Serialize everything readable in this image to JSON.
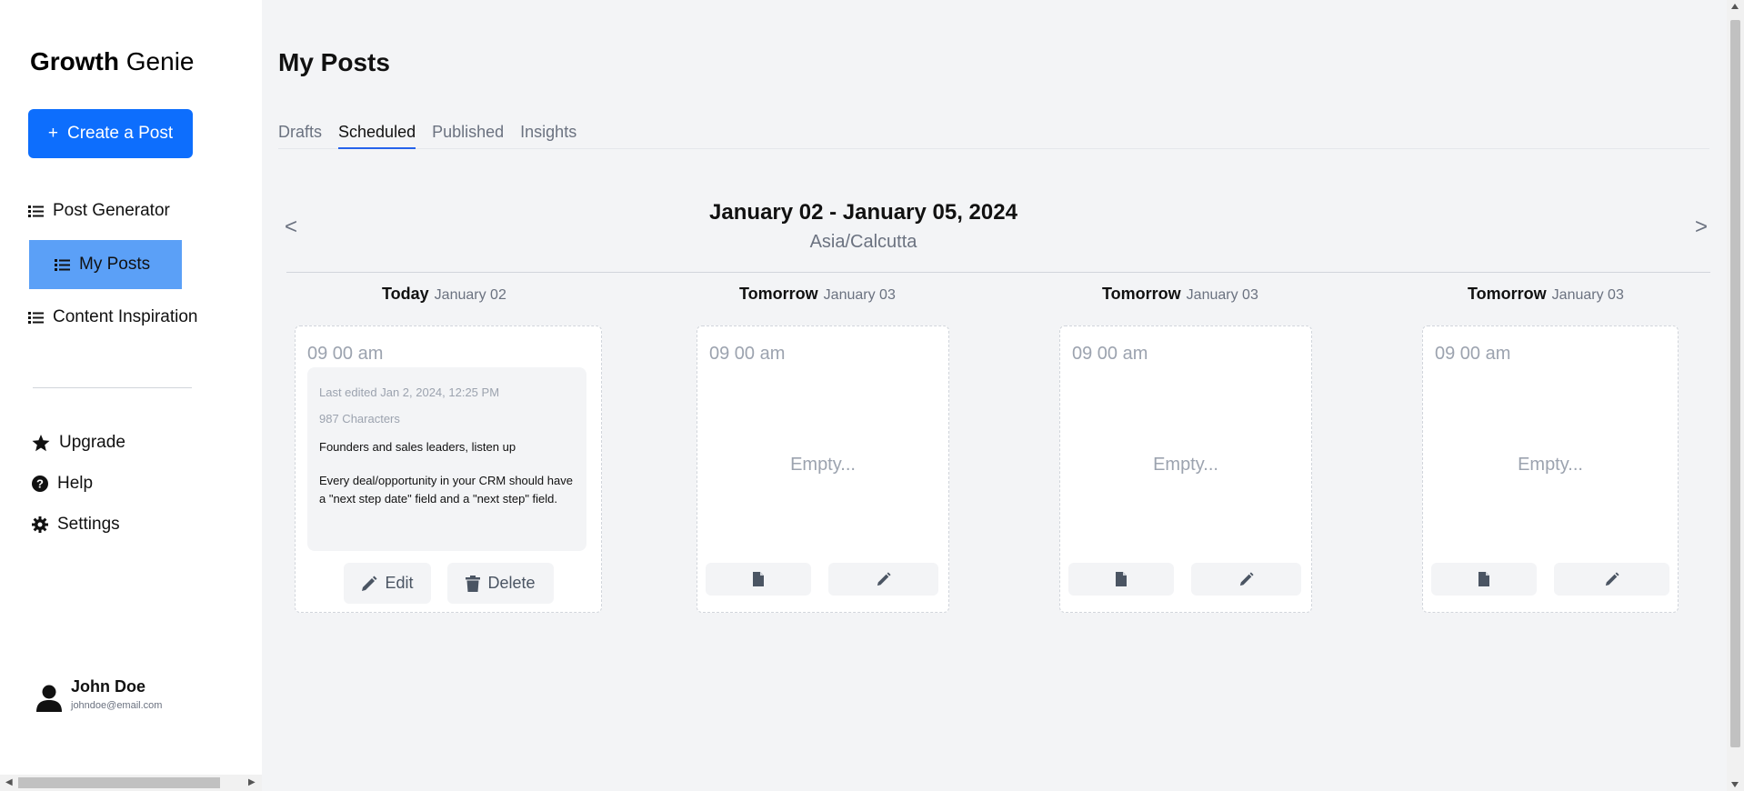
{
  "sidebar": {
    "brand_bold": "Growth",
    "brand_light": "Genie",
    "create_label": "Create a Post",
    "create_plus": "+",
    "nav": [
      {
        "label": "Post Generator",
        "icon": "list-icon"
      },
      {
        "label": "My Posts",
        "icon": "list-icon",
        "active": true
      },
      {
        "label": "Content Inspiration",
        "icon": "list-icon"
      }
    ],
    "secondary": [
      {
        "label": "Upgrade",
        "icon": "star-icon"
      },
      {
        "label": "Help",
        "icon": "question-circle-icon"
      },
      {
        "label": "Settings",
        "icon": "gear-icon"
      }
    ],
    "user": {
      "name": "John Doe",
      "email": "johndoe@email.com"
    }
  },
  "main": {
    "title": "My Posts",
    "tabs": [
      {
        "label": "Drafts"
      },
      {
        "label": "Scheduled",
        "active": true
      },
      {
        "label": "Published"
      },
      {
        "label": "Insights"
      }
    ],
    "range": {
      "title": "January 02 - January 05, 2024",
      "timezone": "Asia/Calcutta",
      "prev": "<",
      "next": ">"
    },
    "columns": [
      {
        "day": "Today",
        "date": "January 02",
        "time": "09 00 am",
        "post": {
          "edited": "Last edited Jan 2, 2024, 12:25 PM",
          "chars": "987 Characters",
          "line1": "Founders and sales leaders, listen up",
          "line2": "Every deal/opportunity in your CRM should have a \"next step date\" field and a \"next step\" field."
        },
        "edit_label": "Edit",
        "delete_label": "Delete"
      },
      {
        "day": "Tomorrow",
        "date": "January 03",
        "time": "09 00 am",
        "empty": "Empty..."
      },
      {
        "day": "Tomorrow",
        "date": "January 03",
        "time": "09 00 am",
        "empty": "Empty..."
      },
      {
        "day": "Tomorrow",
        "date": "January 03",
        "time": "09 00 am",
        "empty": "Empty..."
      }
    ]
  },
  "colors": {
    "primary": "#0d6efd",
    "active_nav": "#5ba0f7",
    "tab_underline": "#2563eb",
    "muted": "#9ca3af"
  }
}
